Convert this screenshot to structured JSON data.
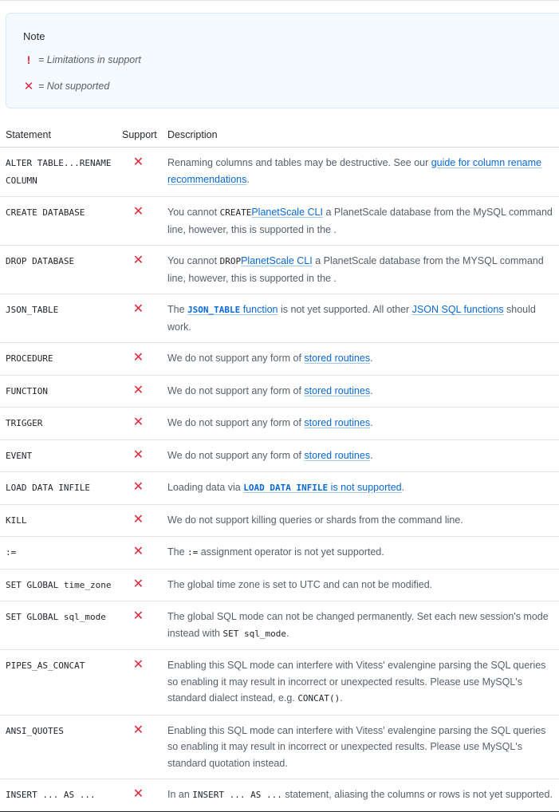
{
  "note": {
    "title": "Note",
    "legend": [
      {
        "symbol": "!",
        "text": "= Limitations in support"
      },
      {
        "symbol": "✕",
        "text": "= Not supported"
      }
    ]
  },
  "table": {
    "headers": [
      "Statement",
      "Support",
      "Description"
    ],
    "unsupported_symbol": "✕",
    "rows": [
      {
        "statement": "ALTER TABLE...RENAME COLUMN",
        "d": {
          "t1": "Renaming columns and tables may be destructive. See our ",
          "l1": "guide for column rename recommendations",
          "t2": "."
        }
      },
      {
        "statement": "CREATE DATABASE",
        "d": {
          "t1": "You cannot ",
          "c1": "CREATE",
          "t2": " a PlanetScale database from the MySQL command line, however, this is supported in the ",
          "l1": "PlanetScale CLI",
          "t3": "."
        }
      },
      {
        "statement": "DROP DATABASE",
        "d": {
          "t1": "You cannot ",
          "c1": "DROP",
          "t2": " a PlanetScale database from the MYSQL command line, however, this is supported in the ",
          "l1": "PlanetScale CLI",
          "t3": "."
        }
      },
      {
        "statement": "JSON_TABLE",
        "d": {
          "t1": "The ",
          "lc1": "JSON_TABLE",
          "l1": " function",
          "t2": " is not yet supported. All other ",
          "l2": "JSON SQL functions",
          "t3": " should work."
        }
      },
      {
        "statement": "PROCEDURE",
        "d": {
          "t1": "We do not support any form of ",
          "l1": "stored routines",
          "t2": "."
        }
      },
      {
        "statement": "FUNCTION",
        "d": {
          "t1": "We do not support any form of ",
          "l1": "stored routines",
          "t2": "."
        }
      },
      {
        "statement": "TRIGGER",
        "d": {
          "t1": "We do not support any form of ",
          "l1": "stored routines",
          "t2": "."
        }
      },
      {
        "statement": "EVENT",
        "d": {
          "t1": "We do not support any form of ",
          "l1": "stored routines",
          "t2": "."
        }
      },
      {
        "statement": "LOAD DATA INFILE",
        "d": {
          "t1": "Loading data via ",
          "lc1": "LOAD DATA INFILE",
          "l1": " is not supported",
          "t2": "."
        }
      },
      {
        "statement": "KILL",
        "d": {
          "t1": "We do not support killing queries or shards from the command line."
        }
      },
      {
        "statement": ":=",
        "d": {
          "t1": "The ",
          "c1": ":=",
          "t2": " assignment operator is not yet supported."
        }
      },
      {
        "statement": "SET GLOBAL time_zone",
        "d": {
          "t1": "The global time zone is set to UTC and can not be modified."
        }
      },
      {
        "statement": "SET GLOBAL sql_mode",
        "d": {
          "t1": "The global SQL mode can not be changed permanently. Set each new session's mode instead with ",
          "c1": "SET sql_mode",
          "t2": "."
        }
      },
      {
        "statement": "PIPES_AS_CONCAT",
        "d": {
          "t1": "Enabling this SQL mode can interfere with Vitess' evalengine parsing the SQL queries so enabling it may result in incorrect or unexpected results. Please use MySQL's standard dialect instead, e.g. ",
          "c1": "CONCAT()",
          "t2": "."
        }
      },
      {
        "statement": "ANSI_QUOTES",
        "d": {
          "t1": "Enabling this SQL mode can interfere with Vitess' evalengine parsing the SQL queries so enabling it may result in incorrect or unexpected results. Please use MySQL's standard quotation instead."
        }
      },
      {
        "statement": "INSERT ... AS ...",
        "d": {
          "t1": "In an ",
          "c1": "INSERT ... AS ...",
          "t2": " statement, aliasing the columns or rows is not yet supported."
        }
      }
    ]
  }
}
